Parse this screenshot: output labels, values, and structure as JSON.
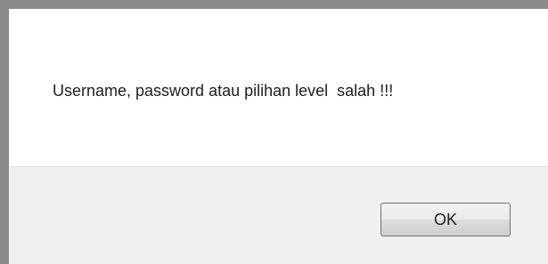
{
  "dialog": {
    "message": "Username, password atau pilihan level  salah !!!",
    "ok_label": "OK"
  },
  "colors": {
    "frame": "#898989",
    "message_background": "#ffffff",
    "button_bar_background": "#f0f0f0",
    "text": "#1e1e1e"
  }
}
